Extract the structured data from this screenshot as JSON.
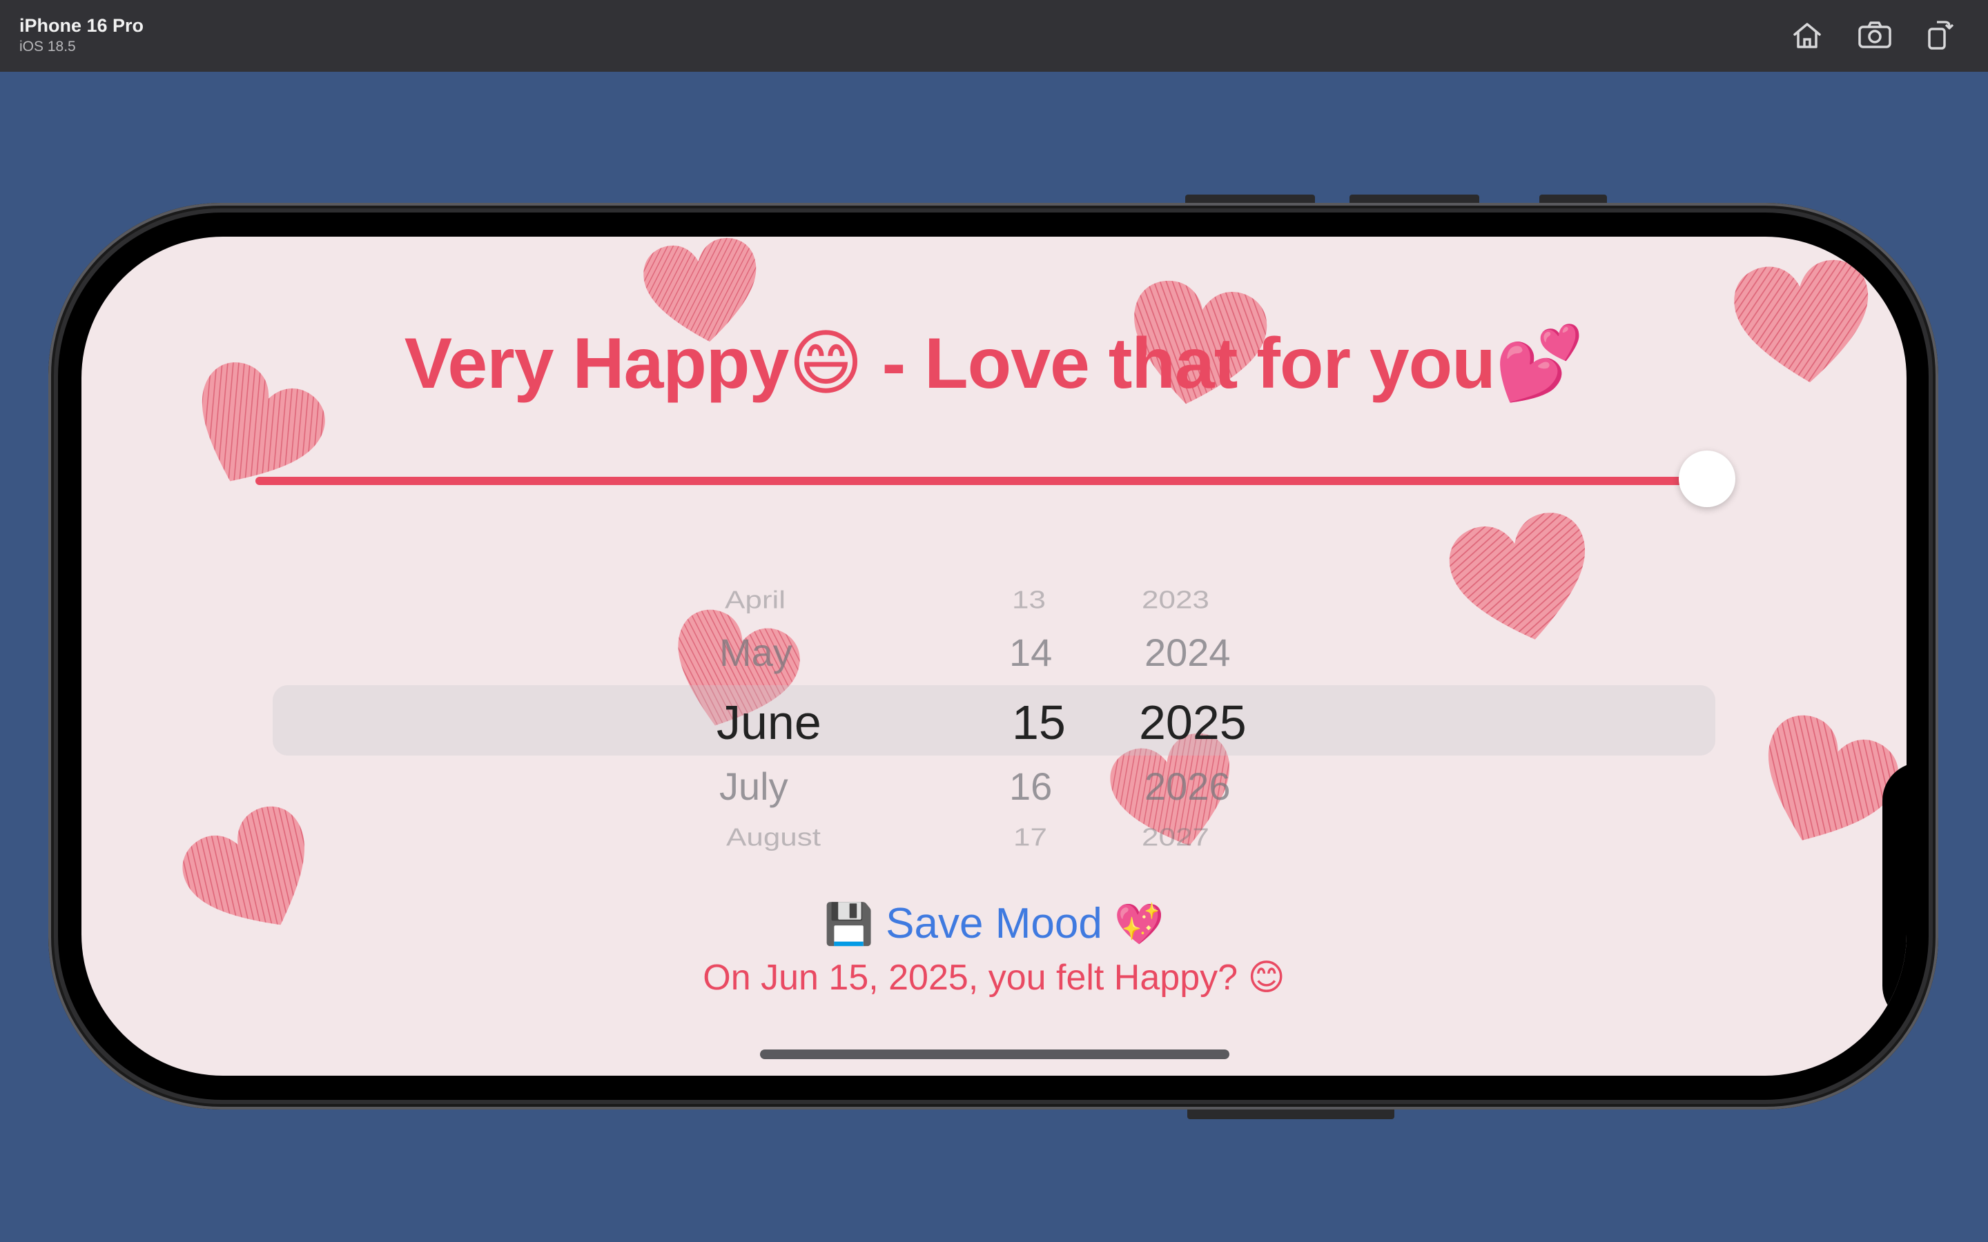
{
  "simulator": {
    "device_name": "iPhone 16 Pro",
    "os_version": "iOS 18.5",
    "toolbar": [
      "home-icon",
      "camera-icon",
      "rotate-icon"
    ]
  },
  "app": {
    "title_text": "Very Happy😄 - Love that for you💕",
    "slider_value": 1.0,
    "date_picker": {
      "months": [
        "April",
        "May",
        "June",
        "July",
        "August"
      ],
      "days": [
        "13",
        "14",
        "15",
        "16",
        "17"
      ],
      "years": [
        "2023",
        "2024",
        "2025",
        "2026",
        "2027"
      ],
      "selected": {
        "month": "June",
        "day": "15",
        "year": "2025"
      }
    },
    "save_button": {
      "icon": "💾",
      "label": "Save Mood",
      "trailing_icon": "💖"
    },
    "summary_text": "On Jun 15, 2025, you felt Happy? 😊"
  },
  "colors": {
    "accent": "#e94a62",
    "link": "#3f7ae0",
    "background": "#f3e7e9",
    "desktop": "#3b5683"
  }
}
